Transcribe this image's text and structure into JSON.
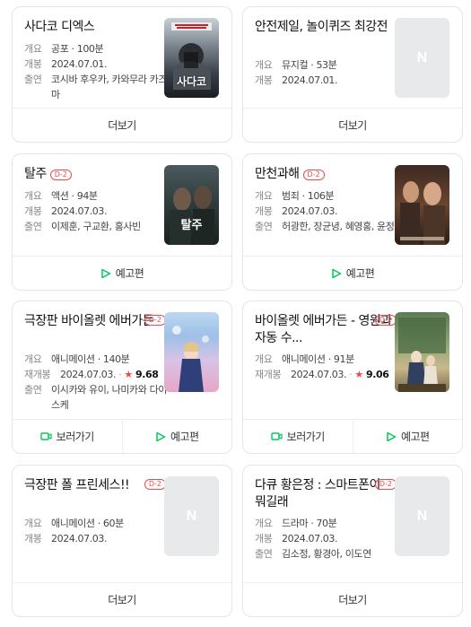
{
  "cards": [
    {
      "title": "사다코 디엑스",
      "badge": "",
      "rows": [
        {
          "label": "개요",
          "value": "공포 · 100분"
        },
        {
          "label": "개봉",
          "value": "2024.07.01."
        },
        {
          "label": "출연",
          "value": "코시바 후우카, 카와무라 카즈마"
        }
      ],
      "poster_text": "사다코",
      "buttons": [
        {
          "label": "더보기",
          "icon": ""
        }
      ]
    },
    {
      "title": "안전제일, 놀이퀴즈 최강전",
      "badge": "",
      "rows": [
        {
          "label": "개요",
          "value": "뮤지컬 · 53분"
        },
        {
          "label": "개봉",
          "value": "2024.07.01."
        }
      ],
      "poster_text": "N",
      "buttons": [
        {
          "label": "더보기",
          "icon": ""
        }
      ]
    },
    {
      "title": "탈주",
      "badge": "D-2",
      "rows": [
        {
          "label": "개요",
          "value": "액션 · 94분"
        },
        {
          "label": "개봉",
          "value": "2024.07.03."
        },
        {
          "label": "출연",
          "value": "이제훈, 구교환, 홍사빈"
        }
      ],
      "poster_text": "탈주",
      "buttons": [
        {
          "label": "예고편",
          "icon": "play-icon"
        }
      ]
    },
    {
      "title": "만천과해",
      "badge": "D-2",
      "rows": [
        {
          "label": "개요",
          "value": "범죄 · 106분"
        },
        {
          "label": "개봉",
          "value": "2024.07.03."
        },
        {
          "label": "출연",
          "value": "허광한, 장균녕, 혜영홍, 윤정"
        }
      ],
      "poster_text": "",
      "buttons": [
        {
          "label": "예고편",
          "icon": "play-icon"
        }
      ]
    },
    {
      "title": "극장판 바이올렛 에버가든",
      "badge": "D-2",
      "rows": [
        {
          "label": "개요",
          "value": "애니메이션 · 140분"
        },
        {
          "label": "재개봉",
          "value": "2024.07.03.",
          "rating": "9.68"
        },
        {
          "label": "출연",
          "value": "이시카와 유이, 나미카와 다이스케"
        }
      ],
      "poster_text": "",
      "buttons": [
        {
          "label": "보러가기",
          "icon": "camera-icon"
        },
        {
          "label": "예고편",
          "icon": "play-icon"
        }
      ]
    },
    {
      "title": "바이올렛 에버가든 - 영원과 자동 수...",
      "badge": "D-2",
      "rows": [
        {
          "label": "개요",
          "value": "애니메이션 · 91분"
        },
        {
          "label": "재개봉",
          "value": "2024.07.03.",
          "rating": "9.06"
        }
      ],
      "poster_text": "",
      "buttons": [
        {
          "label": "보러가기",
          "icon": "camera-icon"
        },
        {
          "label": "예고편",
          "icon": "play-icon"
        }
      ]
    },
    {
      "title": "극장판 폴 프린세스!!",
      "badge": "D-2",
      "rows": [
        {
          "label": "개요",
          "value": "애니메이션 · 60분"
        },
        {
          "label": "개봉",
          "value": "2024.07.03."
        }
      ],
      "poster_text": "N",
      "buttons": [
        {
          "label": "더보기",
          "icon": ""
        }
      ]
    },
    {
      "title": "다큐 황은정 : 스마트폰이 뭐길래",
      "badge": "D-2",
      "rows": [
        {
          "label": "개요",
          "value": "드라마 · 70분"
        },
        {
          "label": "개봉",
          "value": "2024.07.03."
        },
        {
          "label": "출연",
          "value": "김소정, 황경아, 이도연"
        }
      ],
      "poster_text": "N",
      "buttons": [
        {
          "label": "더보기",
          "icon": ""
        }
      ]
    }
  ],
  "colors": {
    "accent": "#03c75a",
    "badge": "#f04848",
    "border": "#e3e5e8"
  }
}
